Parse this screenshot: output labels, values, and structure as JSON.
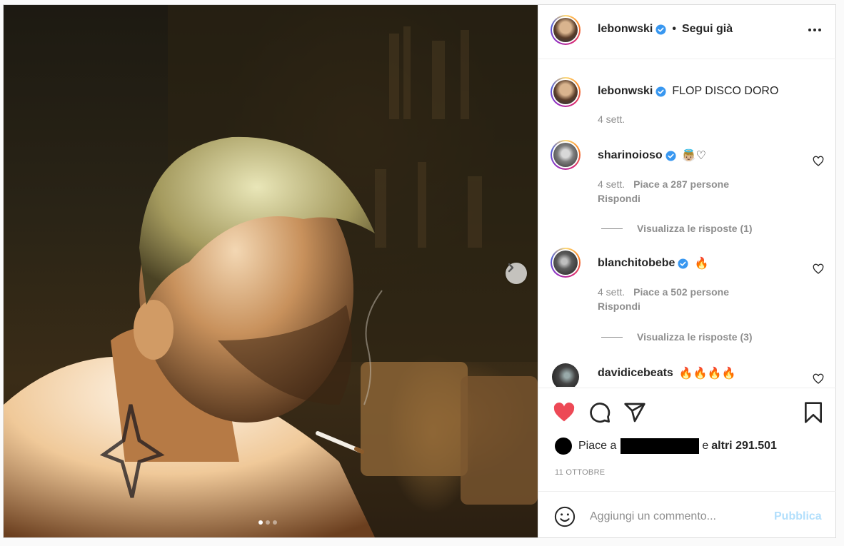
{
  "post": {
    "author": "lebonwski",
    "follow_label": "Segui già",
    "separator": "•",
    "caption": "FLOP DISCO DORO",
    "caption_time": "4 sett.",
    "carousel": {
      "total_slides": 3,
      "active_slide": 1
    }
  },
  "comments": [
    {
      "username": "sharinoioso",
      "verified": true,
      "text": "👼🏼♡",
      "time": "4 sett.",
      "likes": "Piace a 287 persone",
      "reply": "Rispondi",
      "view_replies": "Visualizza le risposte (1)"
    },
    {
      "username": "blanchitobebe",
      "verified": true,
      "text": "🔥",
      "time": "4 sett.",
      "likes": "Piace a 502 persone",
      "reply": "Rispondi",
      "view_replies": "Visualizza le risposte (3)"
    },
    {
      "username": "davidicebeats",
      "verified": false,
      "text": "🔥🔥🔥🔥"
    }
  ],
  "engagement": {
    "liked_prefix": "Piace a",
    "liked_suffix": "e",
    "liked_others": "altri 291.501",
    "date": "11 OTTOBRE"
  },
  "add_comment": {
    "placeholder": "Aggiungi un commento...",
    "publish_label": "Pubblica"
  },
  "colors": {
    "like_red": "#ed4956",
    "verified_blue": "#3897f0",
    "publish_disabled": "#b2dffc",
    "muted_text": "#8e8e8e"
  },
  "icons": [
    "chevron-right-icon",
    "more-horizontal-icon",
    "verified-icon",
    "heart-icon",
    "comment-icon",
    "share-icon",
    "bookmark-icon",
    "smiley-icon"
  ]
}
